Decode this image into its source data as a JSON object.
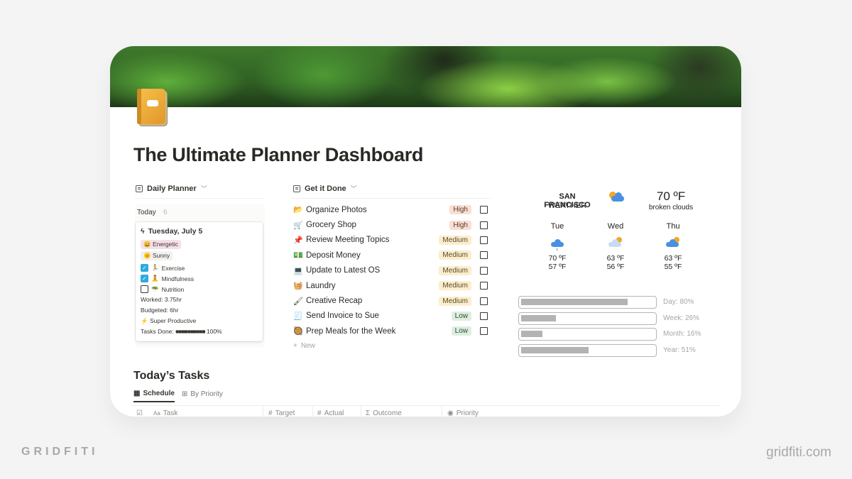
{
  "page": {
    "title": "The Ultimate Planner Dashboard",
    "icon": "notebook-icon"
  },
  "daily_planner": {
    "view_label": "Daily Planner",
    "group_title": "Today",
    "group_count": "6",
    "card": {
      "date": "Tuesday, July 5",
      "mood_tag": "Energetic",
      "mood_emoji": "😄",
      "weather_tag": "Sunny",
      "weather_emoji": "🌞",
      "habits": [
        {
          "label": "Exercise",
          "emoji": "🏃",
          "checked": true
        },
        {
          "label": "Mindfulness",
          "emoji": "🧘",
          "checked": true
        },
        {
          "label": "Nutrition",
          "emoji": "🥗",
          "checked": false
        }
      ],
      "worked": "Worked: 3.75hr",
      "budgeted": "Budgeted: 6hr",
      "productivity": "Super Productive",
      "productivity_emoji": "⚡",
      "tasks_done_label": "Tasks Done:",
      "tasks_done_bar": "■■■■■■■■■■",
      "tasks_done_pct": "100%"
    }
  },
  "get_it_done": {
    "view_label": "Get it Done",
    "new_label": "New",
    "tasks": [
      {
        "emoji": "📂",
        "name": "Organize Photos",
        "priority": "High",
        "level": "high",
        "done": false
      },
      {
        "emoji": "🛒",
        "name": "Grocery Shop",
        "priority": "High",
        "level": "high",
        "done": false
      },
      {
        "emoji": "📌",
        "name": "Review Meeting Topics",
        "priority": "Medium",
        "level": "medium",
        "done": false
      },
      {
        "emoji": "💵",
        "name": "Deposit Money",
        "priority": "Medium",
        "level": "medium",
        "done": false
      },
      {
        "emoji": "💻",
        "name": "Update to Latest OS",
        "priority": "Medium",
        "level": "medium",
        "done": false
      },
      {
        "emoji": "🧺",
        "name": "Laundry",
        "priority": "Medium",
        "level": "medium",
        "done": false
      },
      {
        "emoji": "🖌",
        "name": "Creative Recap",
        "priority": "Medium",
        "level": "medium",
        "done": false
      },
      {
        "emoji": "🧾",
        "name": "Send Invoice to Sue",
        "priority": "Low",
        "level": "low",
        "done": false
      },
      {
        "emoji": "🥘",
        "name": "Prep Meals for the Week",
        "priority": "Low",
        "level": "low",
        "done": false
      }
    ]
  },
  "weather": {
    "city": "SAN FRANCISCO",
    "subtitle": "WEATHER",
    "current_temp": "70 ºF",
    "current_desc": "broken clouds",
    "current_icon": "sun-cloud-icon",
    "forecast": [
      {
        "day": "Tue",
        "hi": "70 ºF",
        "lo": "57 ºF",
        "icon": "rain-cloud-icon"
      },
      {
        "day": "Wed",
        "hi": "63 ºF",
        "lo": "56 ºF",
        "icon": "night-cloud-icon"
      },
      {
        "day": "Thu",
        "hi": "63 ºF",
        "lo": "55 ºF",
        "icon": "night-cloud-icon"
      }
    ]
  },
  "progress": [
    {
      "label": "Day: 80%",
      "value": 80
    },
    {
      "label": "Week: 26%",
      "value": 26
    },
    {
      "label": "Month: 16%",
      "value": 16
    },
    {
      "label": "Year: 51%",
      "value": 51
    }
  ],
  "todays_tasks": {
    "title": "Today’s Tasks",
    "tabs": [
      {
        "label": "Schedule",
        "active": true
      },
      {
        "label": "By Priority",
        "active": false
      }
    ],
    "columns": [
      {
        "label": "",
        "icon": "checkbox-icon"
      },
      {
        "label": "Task",
        "icon": "text-icon"
      },
      {
        "label": "Target",
        "icon": "number-icon"
      },
      {
        "label": "Actual",
        "icon": "number-icon"
      },
      {
        "label": "Outcome",
        "icon": "formula-icon"
      },
      {
        "label": "Priority",
        "icon": "select-icon"
      }
    ]
  },
  "branding": {
    "left": "GRIDFITI",
    "right": "gridfiti.com"
  }
}
